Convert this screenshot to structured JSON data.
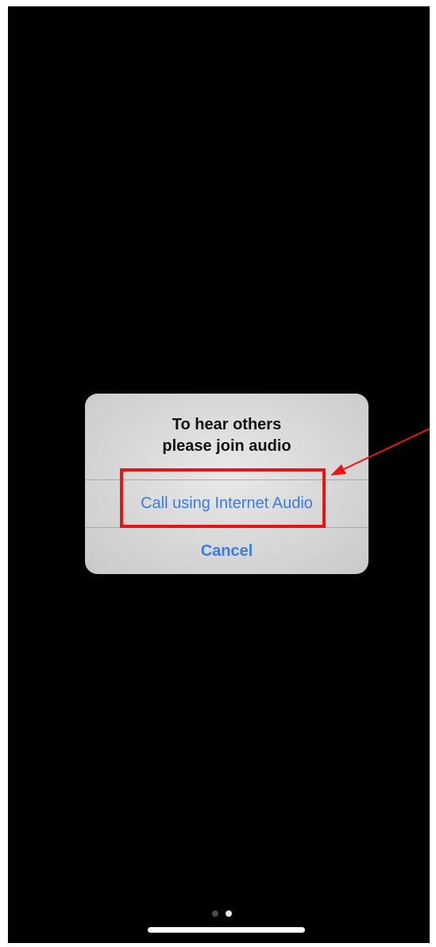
{
  "alert": {
    "title_line1": "To hear others",
    "title_line2": "please join audio",
    "primary_action": "Call using Internet Audio",
    "cancel_action": "Cancel"
  },
  "page_indicator": {
    "total": 2,
    "current": 2
  },
  "colors": {
    "background": "#000000",
    "alert_background": "#dcdcdc",
    "action_text": "#3a7be6",
    "annotation": "#ee1111"
  },
  "icons": [
    "page-dot",
    "home-indicator"
  ]
}
